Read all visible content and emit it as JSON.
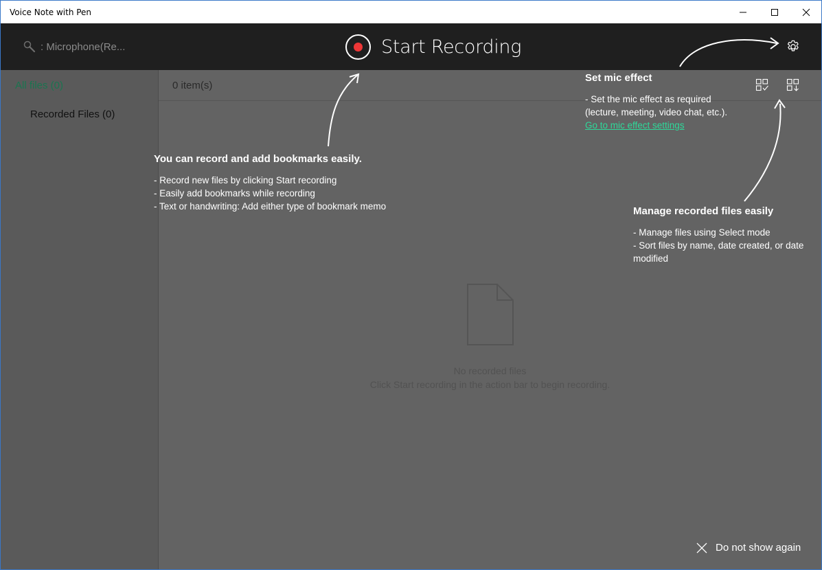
{
  "window": {
    "title": "Voice Note with Pen"
  },
  "appbar": {
    "mic_label": ": Microphone(Re...",
    "start_recording": "Start Recording",
    "record_color": "#ee3737"
  },
  "sidebar": {
    "all_files": "All files (0)",
    "recorded_files": "Recorded Files (0)",
    "accent_color": "#1a7550"
  },
  "main": {
    "item_count": "0 item(s)",
    "empty_title": "No recorded files",
    "empty_subtitle": "Click Start recording in the action bar to begin recording."
  },
  "coach": {
    "record": {
      "title": "You can record and add bookmarks easily.",
      "lines": [
        "- Record new files by clicking Start recording",
        "- Easily add bookmarks while recording",
        "- Text or handwriting: Add either type of bookmark memo"
      ]
    },
    "mic": {
      "title": "Set mic effect",
      "lines": [
        "- Set the mic effect as required",
        "(lecture, meeting, video chat, etc.)."
      ],
      "link": "Go to mic effect settings",
      "link_color": "#2ed99a"
    },
    "manage": {
      "title": "Manage recorded files easily",
      "lines": [
        "- Manage files using Select mode",
        "- Sort files by name, date created, or date modified"
      ]
    },
    "dont_show": "Do not show again"
  },
  "icons": [
    "minimize-icon",
    "maximize-icon",
    "close-icon",
    "microphone-icon",
    "record-icon",
    "gear-icon",
    "select-mode-icon",
    "sort-icon",
    "empty-file-icon",
    "dismiss-icon"
  ]
}
